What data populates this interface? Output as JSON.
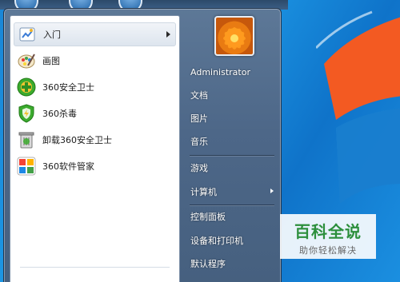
{
  "desktop": {
    "accent_color": "#1a86d6"
  },
  "start_menu": {
    "programs": [
      {
        "label": "入门",
        "icon": "getting-started-icon",
        "has_submenu": true
      },
      {
        "label": "画图",
        "icon": "paint-icon",
        "has_submenu": false
      },
      {
        "label": "360安全卫士",
        "icon": "360-safeguard-icon",
        "has_submenu": false
      },
      {
        "label": "360杀毒",
        "icon": "360-antivirus-icon",
        "has_submenu": false
      },
      {
        "label": "卸载360安全卫士",
        "icon": "uninstall-icon",
        "has_submenu": false
      },
      {
        "label": "360软件管家",
        "icon": "360-software-manager-icon",
        "has_submenu": false
      }
    ],
    "user_name": "Administrator",
    "right_items": [
      {
        "label": "文档"
      },
      {
        "label": "图片"
      },
      {
        "label": "音乐"
      },
      {
        "label": "游戏"
      },
      {
        "label": "计算机",
        "has_submenu": true
      },
      {
        "label": "控制面板"
      },
      {
        "label": "设备和打印机"
      },
      {
        "label": "默认程序"
      }
    ]
  },
  "watermark": {
    "main": "百科全说",
    "sub": "助你轻松解决"
  }
}
